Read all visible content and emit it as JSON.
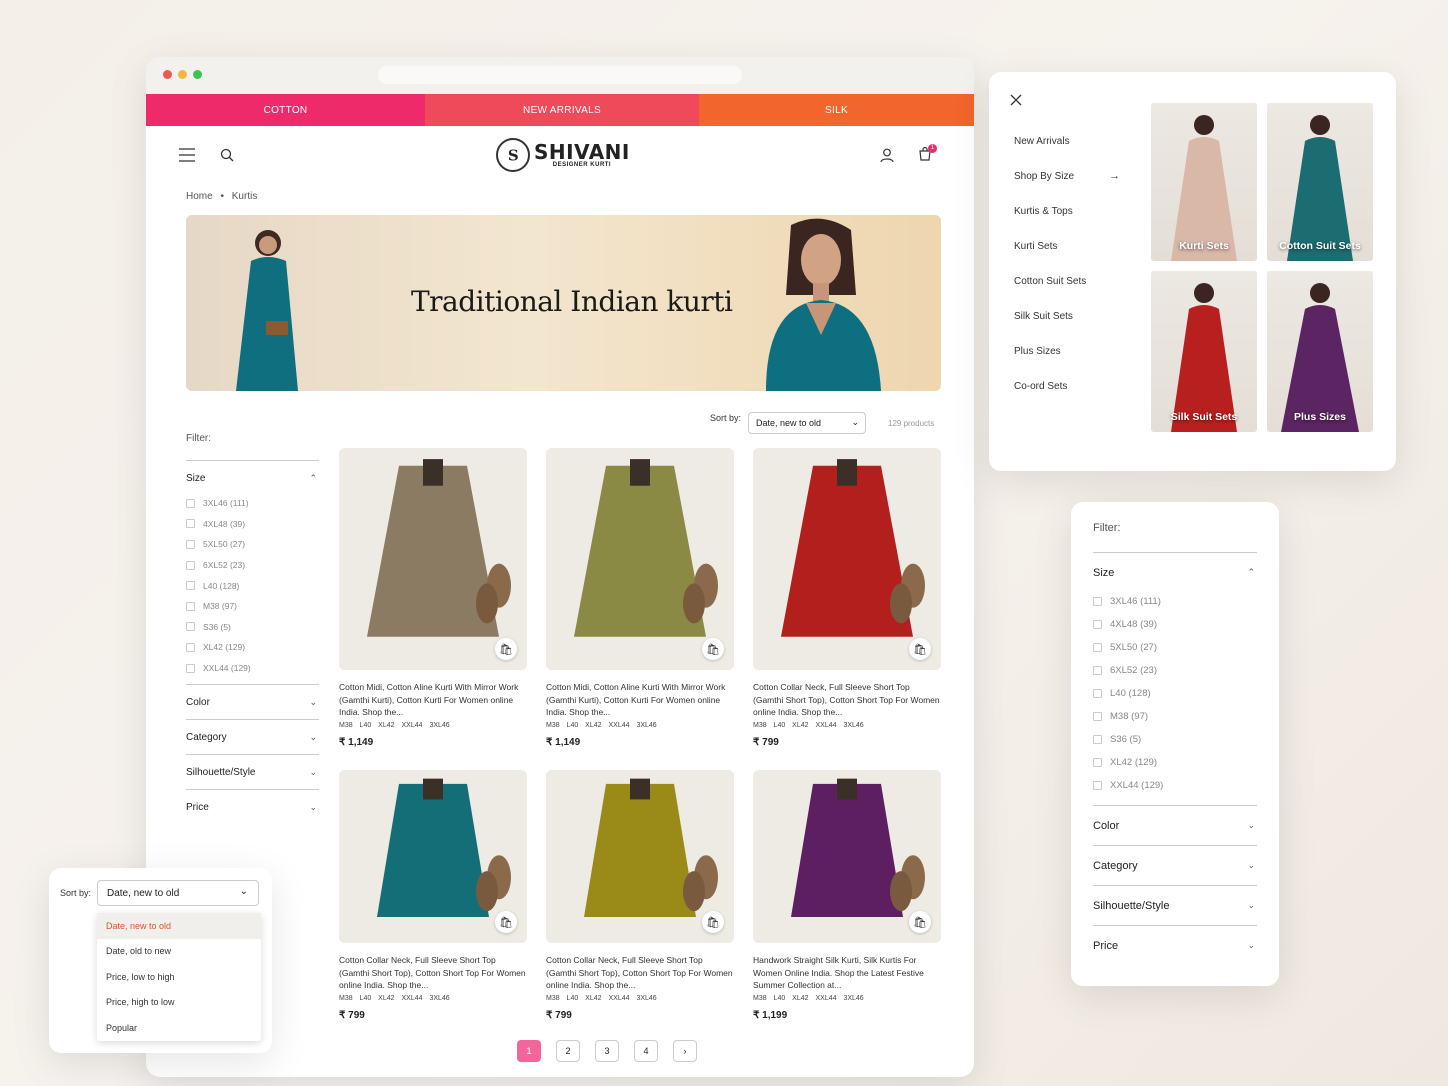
{
  "topnav": [
    {
      "label": "COTTON",
      "color": "#ee2a6b"
    },
    {
      "label": "NEW ARRIVALS",
      "color": "#ef4a59"
    },
    {
      "label": "SILK",
      "color": "#f2652c"
    }
  ],
  "brand": {
    "name": "SHIVANI",
    "tagline": "DESIGNER KURTI",
    "mark": "S"
  },
  "cart_count": "1",
  "breadcrumb": {
    "home": "Home",
    "sep": "•",
    "current": "Kurtis"
  },
  "banner": {
    "title": "Traditional Indian kurti"
  },
  "sort": {
    "label": "Sort by:",
    "selected": "Date, new to old",
    "count": "129 products"
  },
  "filter": {
    "title": "Filter:",
    "size_label": "Size",
    "sizes": [
      "3XL46 (111)",
      "4XL48 (39)",
      "5XL50 (27)",
      "6XL52 (23)",
      "L40 (128)",
      "M38 (97)",
      "S36 (5)",
      "XL42 (129)",
      "XXL44 (129)"
    ],
    "sections": [
      "Color",
      "Category",
      "Silhouette/Style",
      "Price"
    ]
  },
  "products": [
    {
      "name": "Cotton Midi, Cotton Aline Kurti With Mirror Work (Gamthi Kurti), Cotton Kurti For Women online India. Shop the...",
      "sizes": "M38 L40 XL42 XXL44 3XL46",
      "price": "₹ 1,149",
      "color": "#8a7b62"
    },
    {
      "name": "Cotton Midi, Cotton Aline Kurti With Mirror Work (Gamthi Kurti), Cotton Kurti For Women online India. Shop the...",
      "sizes": "M38 L40 XL42 XXL44 3XL46",
      "price": "₹ 1,149",
      "color": "#8a8a45"
    },
    {
      "name": "Cotton Collar Neck, Full Sleeve Short Top (Gamthi Short Top), Cotton Short Top For Women online India. Shop the...",
      "sizes": "M38 L40 XL42 XXL44 3XL46",
      "price": "₹ 799",
      "color": "#b31f1c"
    },
    {
      "name": "Cotton Collar Neck, Full Sleeve Short Top (Gamthi Short Top), Cotton Short Top For Women online India. Shop the...",
      "sizes": "M38 L40 XL42 XXL44 3XL46",
      "price": "₹ 799",
      "color": "#136e78"
    },
    {
      "name": "Cotton Collar Neck, Full Sleeve Short Top (Gamthi Short Top), Cotton Short Top For Women online India. Shop the...",
      "sizes": "M38 L40 XL42 XXL44 3XL46",
      "price": "₹ 799",
      "color": "#9a8a18"
    },
    {
      "name": "Handwork Straight Silk Kurti, Silk Kurtis For Women Online India. Shop the Latest Festive Summer Collection at...",
      "sizes": "M38 L40 XL42 XXL44 3XL46",
      "price": "₹ 1,199",
      "color": "#5e1f62"
    }
  ],
  "pages": [
    "1",
    "2",
    "3",
    "4"
  ],
  "next_icon": "›",
  "menu": {
    "items": [
      "New Arrivals",
      "Shop By Size",
      "Kurtis & Tops",
      "Kurti Sets",
      "Cotton Suit Sets",
      "Silk Suit Sets",
      "Plus Sizes",
      "Co-ord Sets"
    ],
    "arrow": "→",
    "tiles": [
      {
        "label": "Kurti Sets",
        "color": "#d9b8a8"
      },
      {
        "label": "Cotton Suit Sets",
        "color": "#1b6d72"
      },
      {
        "label": "Silk Suit Sets",
        "color": "#b8201f"
      },
      {
        "label": "Plus Sizes",
        "color": "#5b2462"
      }
    ]
  },
  "sort_options": [
    "Date, new to old",
    "Date, old to new",
    "Price, low to high",
    "Price, high to low",
    "Popular"
  ]
}
